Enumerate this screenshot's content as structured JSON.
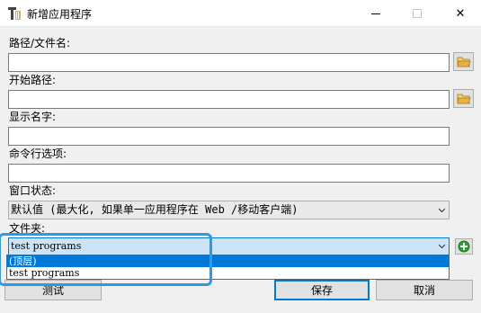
{
  "window": {
    "title": "新增应用程序",
    "controls": {
      "minimize": "minimize-icon",
      "maximize": "maximize-icon",
      "close": "✕"
    }
  },
  "form": {
    "path_label": "路径/文件名:",
    "path_value": "",
    "start_label": "开始路径:",
    "start_value": "",
    "display_label": "显示名字:",
    "display_value": "",
    "cmd_label": "命令行选项:",
    "cmd_value": "",
    "window_state_label": "窗口状态:",
    "window_state_value": "默认值 (最大化, 如果单一应用程序在 Web /移动客户端)",
    "folder_label": "文件夹:",
    "folder_value": "test programs",
    "folder_options": [
      "(顶层)",
      "test programs"
    ],
    "folder_selected_index": 0
  },
  "buttons": {
    "test": "测试",
    "save": "保存",
    "cancel": "取消"
  },
  "colors": {
    "accent": "#0078d7",
    "highlight_box": "#2b9ae8",
    "add_icon": "#2e9e2e",
    "folder_icon": "#e6b340"
  }
}
